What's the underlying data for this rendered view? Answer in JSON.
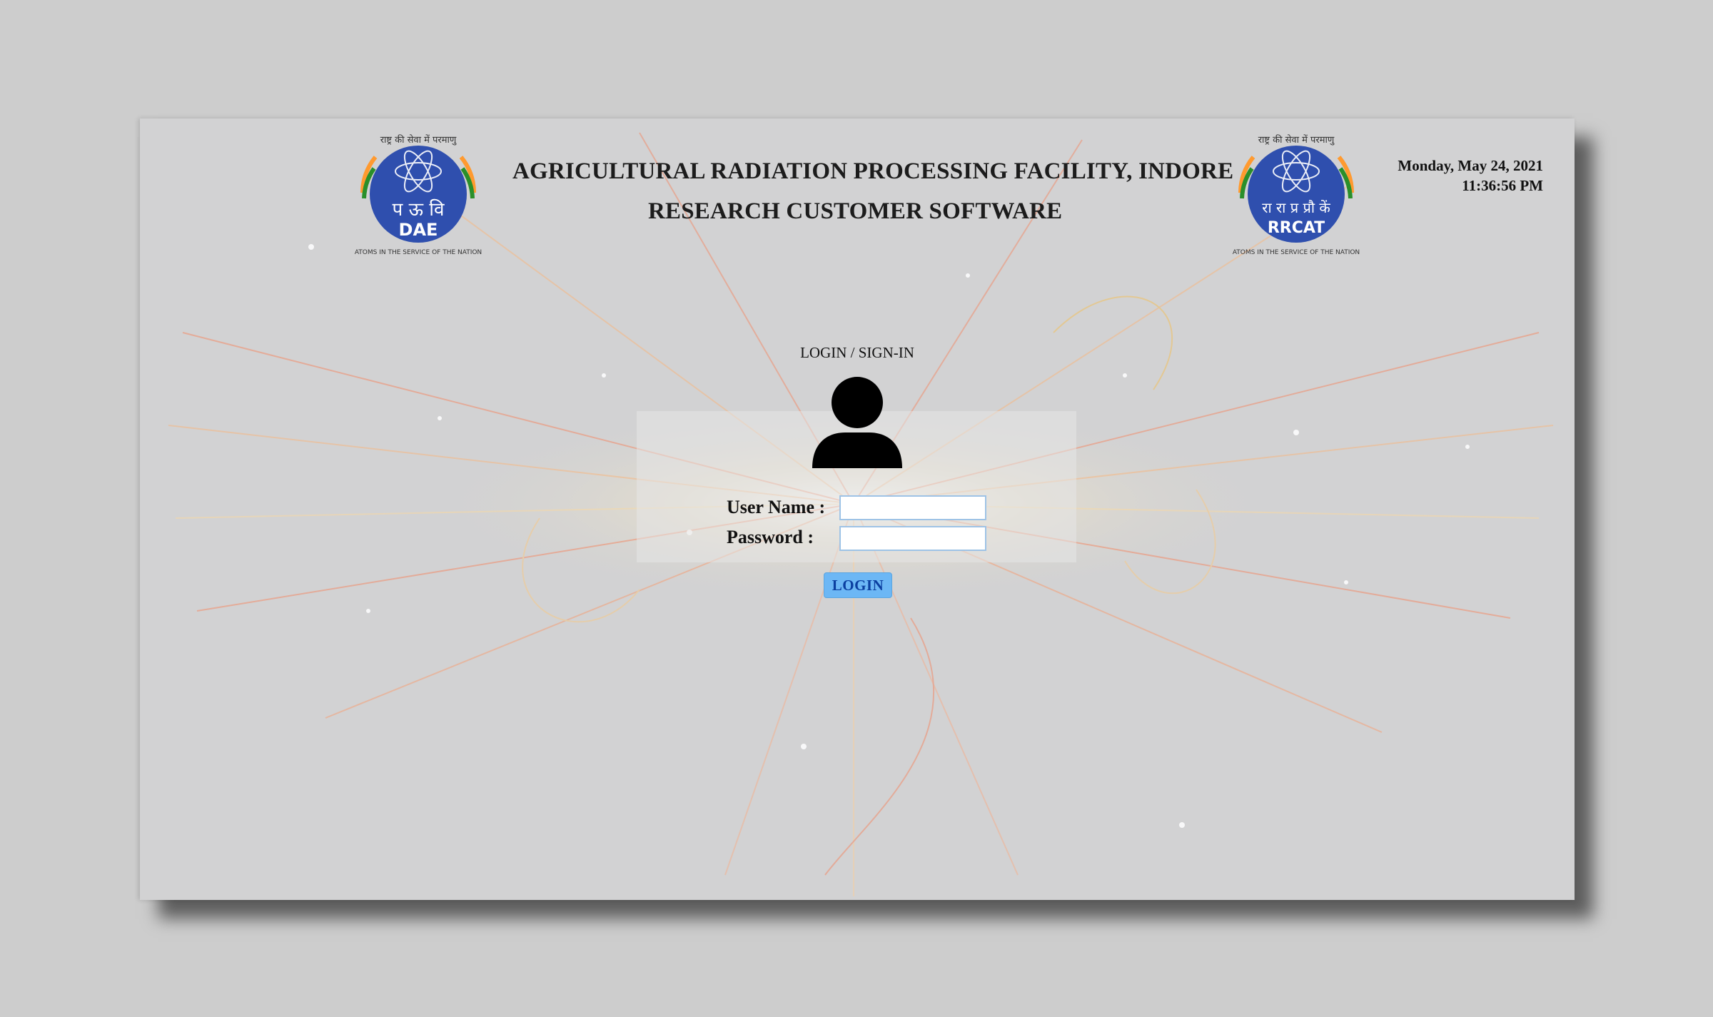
{
  "header": {
    "title_line1": "AGRICULTURAL RADIATION PROCESSING FACILITY, INDORE",
    "title_line2": "RESEARCH CUSTOMER SOFTWARE"
  },
  "logos": {
    "left": {
      "arc_text": "राष्ट्र की सेवा में परमाणु",
      "center_top": "प ऊ वि",
      "center_bottom": "DAE",
      "ring_text": "ATOMS IN THE SERVICE OF THE NATION"
    },
    "right": {
      "arc_text": "राष्ट्र की सेवा में परमाणु",
      "center_top": "रा रा प्र प्रौ कें",
      "center_bottom": "RRCAT",
      "ring_text": "ATOMS IN THE SERVICE OF THE NATION"
    }
  },
  "datetime": {
    "date": "Monday, May 24, 2021",
    "time": "11:36:56 PM"
  },
  "login": {
    "heading": "LOGIN / SIGN-IN",
    "username_label": "User Name :",
    "password_label": "Password :",
    "username_value": "",
    "password_value": "",
    "button_label": "LOGIN"
  },
  "colors": {
    "page_bg": "#cdcdcd",
    "panel_bg": "#d2d2d3",
    "logo_blue": "#2f4fae",
    "button_bg": "#6cb7f5",
    "button_text": "#0b3fa0"
  }
}
